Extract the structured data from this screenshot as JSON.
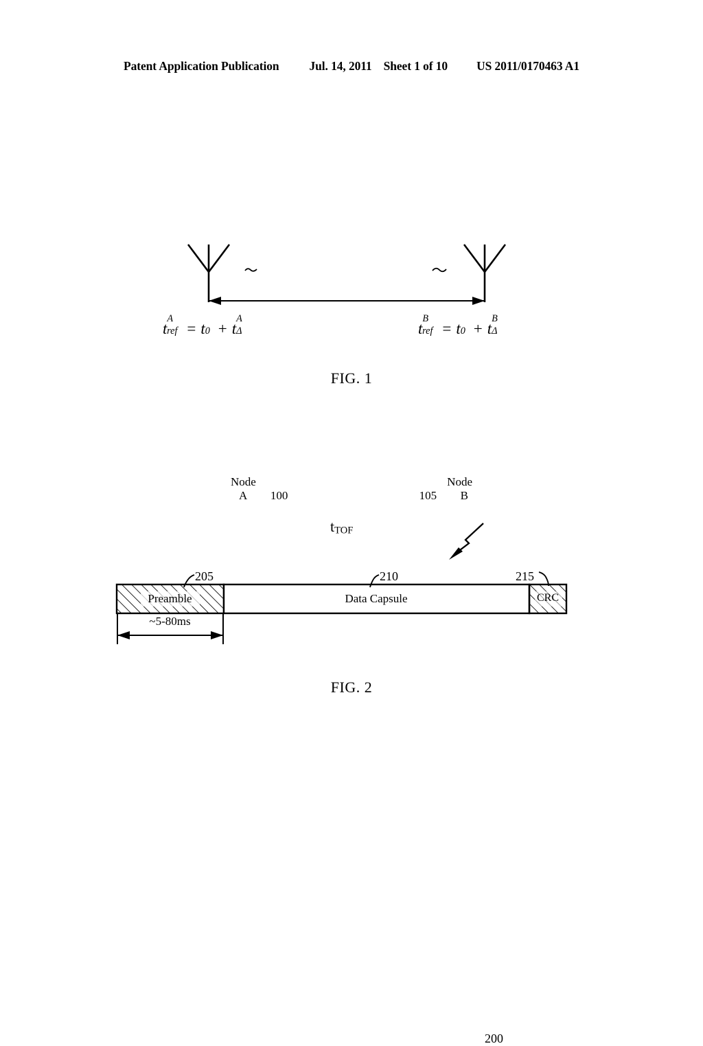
{
  "header": {
    "publication": "Patent Application Publication",
    "date": "Jul. 14, 2011",
    "sheet": "Sheet 1 of 10",
    "patent_number": "US 2011/0170463 A1"
  },
  "figure1": {
    "caption": "FIG. 1",
    "node_a": {
      "title": "Node",
      "letter": "A",
      "reference": "100",
      "icon": "antenna-icon"
    },
    "node_b": {
      "title": "Node",
      "letter": "B",
      "reference": "105",
      "icon": "antenna-icon"
    },
    "distance_label": {
      "base": "t",
      "subscript": "TOF"
    },
    "equation_a": {
      "lhs_base": "t",
      "lhs_sup": "A",
      "lhs_sub": "ref",
      "equals": "=",
      "term1_base": "t",
      "term1_sub": "0",
      "plus": "+",
      "term2_base": "t",
      "term2_sup": "A",
      "term2_sub": "Δ"
    },
    "equation_b": {
      "lhs_base": "t",
      "lhs_sup": "B",
      "lhs_sub": "ref",
      "equals": "=",
      "term1_base": "t",
      "term1_sub": "0",
      "plus": "+",
      "term2_base": "t",
      "term2_sup": "B",
      "term2_sub": "Δ"
    }
  },
  "figure2": {
    "caption": "FIG. 2",
    "packet_reference": "200",
    "fields": [
      {
        "label": "Preamble",
        "reference": "205",
        "fill": "hatched"
      },
      {
        "label": "Data Capsule",
        "reference": "210",
        "fill": "none"
      },
      {
        "label": "CRC",
        "reference": "215",
        "fill": "hatched"
      }
    ],
    "dimension_label": "~5-80ms"
  },
  "colors": {
    "ink": "#000000",
    "paper": "#ffffff"
  }
}
